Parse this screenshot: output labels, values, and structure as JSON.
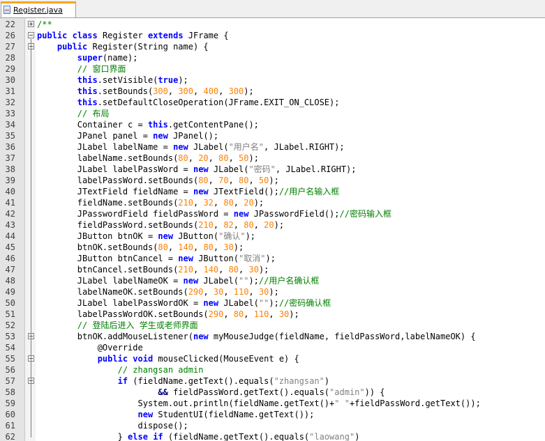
{
  "tab": {
    "label": "Register.java"
  },
  "lines": [
    {
      "n": "22",
      "fold": "plus",
      "tokens": [
        [
          "cm",
          "/**"
        ]
      ]
    },
    {
      "n": "26",
      "fold": "minus",
      "tokens": [
        [
          "kw",
          "public"
        ],
        [
          "t",
          " "
        ],
        [
          "kw",
          "class"
        ],
        [
          "t",
          " Register "
        ],
        [
          "kw",
          "extends"
        ],
        [
          "t",
          " JFrame {"
        ]
      ]
    },
    {
      "n": "27",
      "fold": "minus",
      "tokens": [
        [
          "t",
          "    "
        ],
        [
          "kw",
          "public"
        ],
        [
          "t",
          " Register(String name) {"
        ]
      ]
    },
    {
      "n": "28",
      "tokens": [
        [
          "t",
          "        "
        ],
        [
          "kw",
          "super"
        ],
        [
          "t",
          "(name);"
        ]
      ]
    },
    {
      "n": "29",
      "tokens": [
        [
          "t",
          "        "
        ],
        [
          "cm",
          "// 窗口界面"
        ]
      ]
    },
    {
      "n": "30",
      "tokens": [
        [
          "t",
          "        "
        ],
        [
          "kw",
          "this"
        ],
        [
          "t",
          ".setVisible("
        ],
        [
          "kw",
          "true"
        ],
        [
          "t",
          ");"
        ]
      ]
    },
    {
      "n": "31",
      "tokens": [
        [
          "t",
          "        "
        ],
        [
          "kw",
          "this"
        ],
        [
          "t",
          ".setBounds("
        ],
        [
          "num",
          "300"
        ],
        [
          "t",
          ", "
        ],
        [
          "num",
          "300"
        ],
        [
          "t",
          ", "
        ],
        [
          "num",
          "400"
        ],
        [
          "t",
          ", "
        ],
        [
          "num",
          "300"
        ],
        [
          "t",
          ");"
        ]
      ]
    },
    {
      "n": "32",
      "tokens": [
        [
          "t",
          "        "
        ],
        [
          "kw",
          "this"
        ],
        [
          "t",
          ".setDefaultCloseOperation(JFrame.EXIT_ON_CLOSE);"
        ]
      ]
    },
    {
      "n": "33",
      "tokens": [
        [
          "t",
          "        "
        ],
        [
          "cm",
          "// 布局"
        ]
      ]
    },
    {
      "n": "34",
      "tokens": [
        [
          "t",
          "        Container c = "
        ],
        [
          "kw",
          "this"
        ],
        [
          "t",
          ".getContentPane();"
        ]
      ]
    },
    {
      "n": "35",
      "tokens": [
        [
          "t",
          "        JPanel panel = "
        ],
        [
          "kw",
          "new"
        ],
        [
          "t",
          " JPanel();"
        ]
      ]
    },
    {
      "n": "36",
      "tokens": [
        [
          "t",
          "        JLabel labelName = "
        ],
        [
          "kw",
          "new"
        ],
        [
          "t",
          " JLabel("
        ],
        [
          "str",
          "\"用户名\""
        ],
        [
          "t",
          ", JLabel.RIGHT);"
        ]
      ]
    },
    {
      "n": "37",
      "tokens": [
        [
          "t",
          "        labelName.setBounds("
        ],
        [
          "num",
          "80"
        ],
        [
          "t",
          ", "
        ],
        [
          "num",
          "20"
        ],
        [
          "t",
          ", "
        ],
        [
          "num",
          "80"
        ],
        [
          "t",
          ", "
        ],
        [
          "num",
          "50"
        ],
        [
          "t",
          ");"
        ]
      ]
    },
    {
      "n": "38",
      "tokens": [
        [
          "t",
          "        JLabel labelPassWord = "
        ],
        [
          "kw",
          "new"
        ],
        [
          "t",
          " JLabel("
        ],
        [
          "str",
          "\"密码\""
        ],
        [
          "t",
          ", JLabel.RIGHT);"
        ]
      ]
    },
    {
      "n": "39",
      "tokens": [
        [
          "t",
          "        labelPassWord.setBounds("
        ],
        [
          "num",
          "80"
        ],
        [
          "t",
          ", "
        ],
        [
          "num",
          "70"
        ],
        [
          "t",
          ", "
        ],
        [
          "num",
          "80"
        ],
        [
          "t",
          ", "
        ],
        [
          "num",
          "50"
        ],
        [
          "t",
          ");"
        ]
      ]
    },
    {
      "n": "40",
      "tokens": [
        [
          "t",
          "        JTextField fieldName = "
        ],
        [
          "kw",
          "new"
        ],
        [
          "t",
          " JTextField();"
        ],
        [
          "cm",
          "//用户名输入框"
        ]
      ]
    },
    {
      "n": "41",
      "tokens": [
        [
          "t",
          "        fieldName.setBounds("
        ],
        [
          "num",
          "210"
        ],
        [
          "t",
          ", "
        ],
        [
          "num",
          "32"
        ],
        [
          "t",
          ", "
        ],
        [
          "num",
          "80"
        ],
        [
          "t",
          ", "
        ],
        [
          "num",
          "20"
        ],
        [
          "t",
          ");"
        ]
      ]
    },
    {
      "n": "42",
      "tokens": [
        [
          "t",
          "        JPasswordField fieldPassWord = "
        ],
        [
          "kw",
          "new"
        ],
        [
          "t",
          " JPasswordField();"
        ],
        [
          "cm",
          "//密码输入框"
        ]
      ]
    },
    {
      "n": "43",
      "tokens": [
        [
          "t",
          "        fieldPassWord.setBounds("
        ],
        [
          "num",
          "210"
        ],
        [
          "t",
          ", "
        ],
        [
          "num",
          "82"
        ],
        [
          "t",
          ", "
        ],
        [
          "num",
          "80"
        ],
        [
          "t",
          ", "
        ],
        [
          "num",
          "20"
        ],
        [
          "t",
          ");"
        ]
      ]
    },
    {
      "n": "44",
      "tokens": [
        [
          "t",
          "        JButton btnOK = "
        ],
        [
          "kw",
          "new"
        ],
        [
          "t",
          " JButton("
        ],
        [
          "str",
          "\"确认\""
        ],
        [
          "t",
          ");"
        ]
      ]
    },
    {
      "n": "45",
      "tokens": [
        [
          "t",
          "        btnOK.setBounds("
        ],
        [
          "num",
          "80"
        ],
        [
          "t",
          ", "
        ],
        [
          "num",
          "140"
        ],
        [
          "t",
          ", "
        ],
        [
          "num",
          "80"
        ],
        [
          "t",
          ", "
        ],
        [
          "num",
          "30"
        ],
        [
          "t",
          ");"
        ]
      ]
    },
    {
      "n": "46",
      "tokens": [
        [
          "t",
          "        JButton btnCancel = "
        ],
        [
          "kw",
          "new"
        ],
        [
          "t",
          " JButton("
        ],
        [
          "str",
          "\"取消\""
        ],
        [
          "t",
          ");"
        ]
      ]
    },
    {
      "n": "47",
      "tokens": [
        [
          "t",
          "        btnCancel.setBounds("
        ],
        [
          "num",
          "210"
        ],
        [
          "t",
          ", "
        ],
        [
          "num",
          "140"
        ],
        [
          "t",
          ", "
        ],
        [
          "num",
          "80"
        ],
        [
          "t",
          ", "
        ],
        [
          "num",
          "30"
        ],
        [
          "t",
          ");"
        ]
      ]
    },
    {
      "n": "48",
      "tokens": [
        [
          "t",
          "        JLabel labelNameOK = "
        ],
        [
          "kw",
          "new"
        ],
        [
          "t",
          " JLabel("
        ],
        [
          "str",
          "\"\""
        ],
        [
          "t",
          ");"
        ],
        [
          "cm",
          "//用户名确认框"
        ]
      ]
    },
    {
      "n": "49",
      "tokens": [
        [
          "t",
          "        labelNameOK.setBounds("
        ],
        [
          "num",
          "290"
        ],
        [
          "t",
          ", "
        ],
        [
          "num",
          "30"
        ],
        [
          "t",
          ", "
        ],
        [
          "num",
          "110"
        ],
        [
          "t",
          ", "
        ],
        [
          "num",
          "30"
        ],
        [
          "t",
          ");"
        ]
      ]
    },
    {
      "n": "50",
      "tokens": [
        [
          "t",
          "        JLabel labelPassWordOK = "
        ],
        [
          "kw",
          "new"
        ],
        [
          "t",
          " JLabel("
        ],
        [
          "str",
          "\"\""
        ],
        [
          "t",
          ");"
        ],
        [
          "cm",
          "//密码确认框"
        ]
      ]
    },
    {
      "n": "51",
      "tokens": [
        [
          "t",
          "        labelPassWordOK.setBounds("
        ],
        [
          "num",
          "290"
        ],
        [
          "t",
          ", "
        ],
        [
          "num",
          "80"
        ],
        [
          "t",
          ", "
        ],
        [
          "num",
          "110"
        ],
        [
          "t",
          ", "
        ],
        [
          "num",
          "30"
        ],
        [
          "t",
          ");"
        ]
      ]
    },
    {
      "n": "52",
      "tokens": [
        [
          "t",
          "        "
        ],
        [
          "cm",
          "// 登陆后进入 学生或老师界面"
        ]
      ]
    },
    {
      "n": "53",
      "fold": "minus",
      "tokens": [
        [
          "t",
          "        btnOK.addMouseListener("
        ],
        [
          "kw",
          "new"
        ],
        [
          "t",
          " myMouseJudge(fieldName, fieldPassWord,labelNameOK) {"
        ]
      ]
    },
    {
      "n": "54",
      "tokens": [
        [
          "t",
          "            @Override"
        ]
      ]
    },
    {
      "n": "55",
      "fold": "minus",
      "tokens": [
        [
          "t",
          "            "
        ],
        [
          "kw",
          "public"
        ],
        [
          "t",
          " "
        ],
        [
          "kw",
          "void"
        ],
        [
          "t",
          " mouseClicked(MouseEvent e) {"
        ]
      ]
    },
    {
      "n": "56",
      "tokens": [
        [
          "t",
          "                "
        ],
        [
          "cm",
          "// zhangsan admin"
        ]
      ]
    },
    {
      "n": "57",
      "fold": "minus",
      "tokens": [
        [
          "t",
          "                "
        ],
        [
          "kw",
          "if"
        ],
        [
          "t",
          " (fieldName.getText().equals("
        ],
        [
          "str",
          "\"zhangsan\""
        ],
        [
          "t",
          ")"
        ]
      ]
    },
    {
      "n": "58",
      "tokens": [
        [
          "t",
          "                        "
        ],
        [
          "op",
          "&&"
        ],
        [
          "t",
          " fieldPassWord.getText().equals("
        ],
        [
          "str",
          "\"admin\""
        ],
        [
          "t",
          ")) {"
        ]
      ]
    },
    {
      "n": "59",
      "tokens": [
        [
          "t",
          "                    System.out.println(fieldName.getText()+"
        ],
        [
          "str",
          "\" \""
        ],
        [
          "t",
          "+fieldPassWord.getText());"
        ]
      ]
    },
    {
      "n": "60",
      "tokens": [
        [
          "t",
          "                    "
        ],
        [
          "kw",
          "new"
        ],
        [
          "t",
          " StudentUI(fieldName.getText());"
        ]
      ]
    },
    {
      "n": "61",
      "tokens": [
        [
          "t",
          "                    dispose();"
        ]
      ]
    },
    {
      "n": "62",
      "tokens": [
        [
          "t",
          "                } "
        ],
        [
          "kw",
          "else"
        ],
        [
          "t",
          " "
        ],
        [
          "kw",
          "if"
        ],
        [
          "t",
          " (fieldName.getText().equals("
        ],
        [
          "str",
          "\"laowang\""
        ],
        [
          "t",
          ")"
        ]
      ]
    }
  ]
}
